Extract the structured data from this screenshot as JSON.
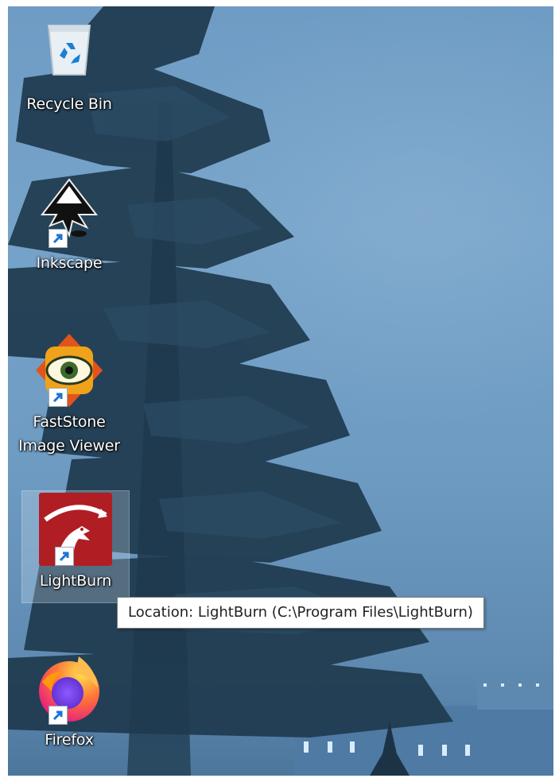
{
  "desktop": {
    "icons": [
      {
        "label": "Recycle Bin",
        "icon": "recycle-bin-icon",
        "shortcut": false
      },
      {
        "label": "Inkscape",
        "icon": "inkscape-icon",
        "shortcut": true
      },
      {
        "label_line1": "FastStone",
        "label_line2": "Image Viewer",
        "icon": "faststone-icon",
        "shortcut": true
      },
      {
        "label": "LightBurn",
        "icon": "lightburn-icon",
        "shortcut": true,
        "selected": true
      },
      {
        "label": "Firefox",
        "icon": "firefox-icon",
        "shortcut": true
      }
    ],
    "tooltip": "Location: LightBurn (C:\\Program Files\\LightBurn)"
  },
  "colors": {
    "sky": "#6f9cc4",
    "tree": "#1f3a4e",
    "tooltip_bg": "#ffffff",
    "lightburn_red": "#b01e24",
    "firefox_orange": "#ff7139"
  }
}
